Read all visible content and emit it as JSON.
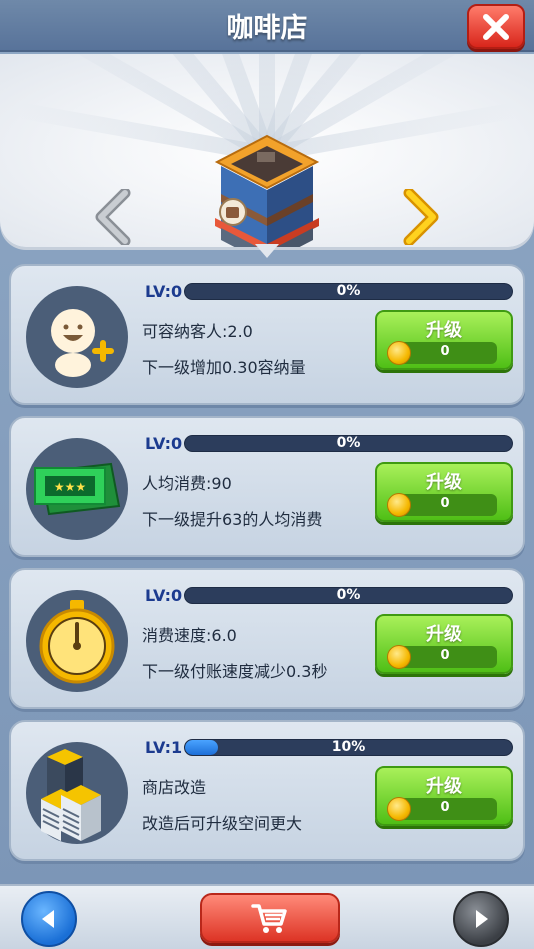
{
  "header": {
    "title": "咖啡店"
  },
  "carousel": {
    "page_count": 10,
    "active_index": 0
  },
  "upgrades": [
    {
      "lv": "LV:0",
      "progress_text": "0%",
      "progress": 0.0,
      "line1": "可容纳客人:2.0",
      "line2": "下一级增加0.30容纳量",
      "button": "升级",
      "cost": "0",
      "icon": "customer-icon"
    },
    {
      "lv": "LV:0",
      "progress_text": "0%",
      "progress": 0.0,
      "line1": "人均消费:90",
      "line2": "下一级提升63的人均消费",
      "button": "升级",
      "cost": "0",
      "icon": "ticket-icon"
    },
    {
      "lv": "LV:0",
      "progress_text": "0%",
      "progress": 0.0,
      "line1": "消费速度:6.0",
      "line2": "下一级付账速度减少0.3秒",
      "button": "升级",
      "cost": "0",
      "icon": "stopwatch-icon"
    },
    {
      "lv": "LV:1",
      "progress_text": "10%",
      "progress": 0.1,
      "line1": "商店改造",
      "line2": "改造后可升级空间更大",
      "button": "升级",
      "cost": "0",
      "icon": "buildings-icon"
    }
  ],
  "colors": {
    "progress_fill": "#1c6fd8",
    "upgrade_button": "#4fbf16",
    "close_button": "#d8261b",
    "active_dot": "#f26b22"
  }
}
